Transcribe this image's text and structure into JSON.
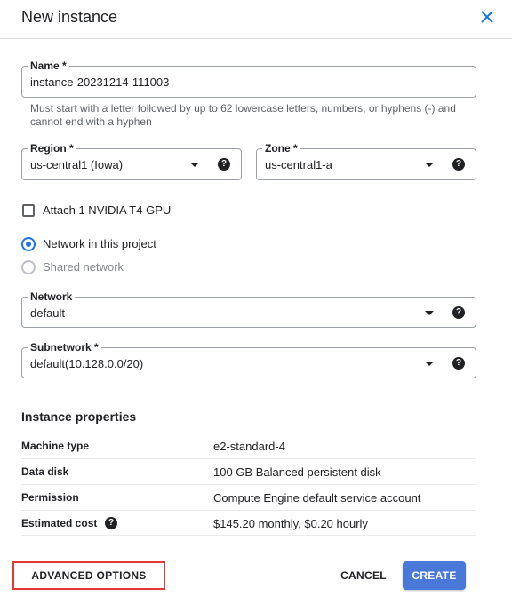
{
  "dialog": {
    "title": "New instance",
    "close_icon": "close-icon"
  },
  "form": {
    "name": {
      "label": "Name *",
      "value": "instance-20231214-111003",
      "hint": "Must start with a letter followed by up to 62 lowercase letters, numbers, or hyphens (-) and cannot end with a hyphen"
    },
    "region": {
      "label": "Region *",
      "value": "us-central1 (Iowa)",
      "help": "?"
    },
    "zone": {
      "label": "Zone *",
      "value": "us-central1-a",
      "help": "?"
    },
    "gpu": {
      "label": "Attach 1 NVIDIA T4 GPU",
      "checked": false
    },
    "network_choice": {
      "options": [
        {
          "label": "Network in this project",
          "selected": true
        },
        {
          "label": "Shared network",
          "selected": false
        }
      ]
    },
    "network": {
      "label": "Network",
      "value": "default",
      "help": "?"
    },
    "subnetwork": {
      "label": "Subnetwork *",
      "value": "default(10.128.0.0/20)",
      "help": "?"
    }
  },
  "properties": {
    "title": "Instance properties",
    "rows": [
      {
        "key": "Machine type",
        "value": "e2-standard-4"
      },
      {
        "key": "Data disk",
        "value": "100 GB Balanced persistent disk"
      },
      {
        "key": "Permission",
        "value": "Compute Engine default service account"
      },
      {
        "key": "Estimated cost",
        "value": "$145.20 monthly, $0.20 hourly",
        "help": "?"
      }
    ]
  },
  "footer": {
    "advanced_label": "ADVANCED OPTIONS",
    "cancel_label": "CANCEL",
    "create_label": "CREATE"
  },
  "colors": {
    "accent": "#1a73e8",
    "create_button": "#4a78d8",
    "highlight_border": "#e53935"
  }
}
